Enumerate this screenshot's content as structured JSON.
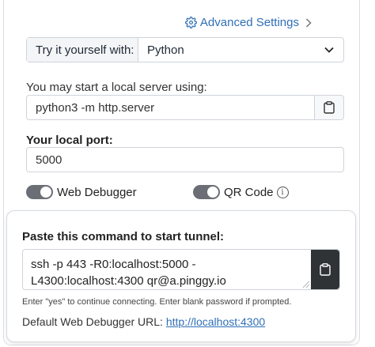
{
  "advanced_settings": {
    "label": "Advanced Settings"
  },
  "try": {
    "label": "Try it yourself with:",
    "selected": "Python"
  },
  "server": {
    "label": "You may start a local server using:",
    "command": "python3 -m http.server"
  },
  "port": {
    "label": "Your local port:",
    "value": "5000"
  },
  "toggles": {
    "web_debugger": {
      "label": "Web Debugger",
      "on": true
    },
    "qr_code": {
      "label": "QR Code",
      "on": true
    }
  },
  "tunnel": {
    "title": "Paste this command to start tunnel:",
    "command_line1": "ssh -p 443 -R0:localhost:5000 -",
    "command_line2": "L4300:localhost:4300 qr@a.pinggy.io",
    "hint": "Enter \"yes\" to continue connecting. Enter blank password if prompted.",
    "debugger_url_label": "Default Web Debugger URL:",
    "debugger_url": "http://localhost:4300"
  },
  "colors": {
    "link": "#2f6fb6",
    "toggle": "#6b6f75",
    "copy_dark": "#2f3336"
  }
}
